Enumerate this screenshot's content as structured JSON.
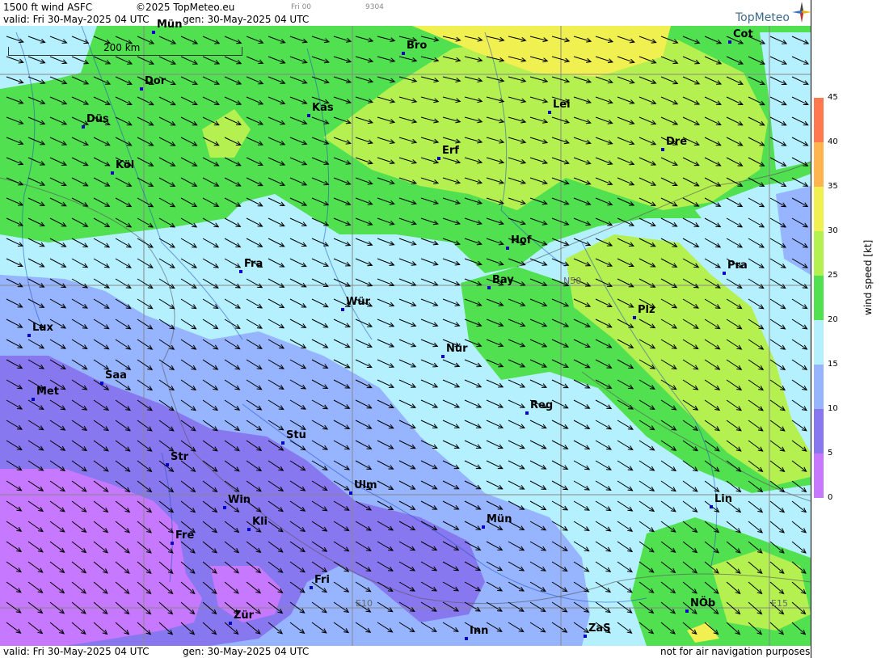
{
  "header": {
    "product": "1500 ft wind ASFC",
    "copyright": "©2025 TopMeteo.eu",
    "valid_line": "valid:  Fri  30-May-2025  04 UTC",
    "gen_line": "gen: 30-May-2025 04 UTC",
    "small_tag_1": "Fri 00",
    "small_tag_2": "9304",
    "brand": "TopMeteo"
  },
  "footer": {
    "valid_line": "valid:  Fri  30-May-2025  04 UTC",
    "gen_line": "gen: 30-May-2025 04 UTC",
    "disclaimer": "not for air navigation purposes"
  },
  "scale": {
    "label": "200 km"
  },
  "legend": {
    "title": "wind speed [kt]",
    "ticks": [
      "0",
      "5",
      "10",
      "15",
      "20",
      "25",
      "30",
      "35",
      "40",
      "45"
    ],
    "colors": [
      "#c678ff",
      "#8878f0",
      "#96b4ff",
      "#b4f0ff",
      "#50e050",
      "#b4f050",
      "#f0f050",
      "#ffb450",
      "#ff7850"
    ]
  },
  "grid_labels": {
    "n50": "N50",
    "e10": "E10",
    "e15": "E15"
  },
  "cities": [
    {
      "name": "Mün"
    },
    {
      "name": "Bro"
    },
    {
      "name": "Cot"
    },
    {
      "name": "Dor"
    },
    {
      "name": "Kas"
    },
    {
      "name": "Lei"
    },
    {
      "name": "Düs"
    },
    {
      "name": "Erf"
    },
    {
      "name": "Dre"
    },
    {
      "name": "Köl"
    },
    {
      "name": "Hof"
    },
    {
      "name": "Fra"
    },
    {
      "name": "Pra"
    },
    {
      "name": "Bay"
    },
    {
      "name": "Wür"
    },
    {
      "name": "Plz"
    },
    {
      "name": "Lux"
    },
    {
      "name": "Nür"
    },
    {
      "name": "Saa"
    },
    {
      "name": "Met"
    },
    {
      "name": "Reg"
    },
    {
      "name": "Stu"
    },
    {
      "name": "Str"
    },
    {
      "name": "Ulm"
    },
    {
      "name": "Lin"
    },
    {
      "name": "Win"
    },
    {
      "name": "Kli"
    },
    {
      "name": "Mün"
    },
    {
      "name": "Fre"
    },
    {
      "name": "Fri"
    },
    {
      "name": "NÖb"
    },
    {
      "name": "Zür"
    },
    {
      "name": "ZaS"
    },
    {
      "name": "Inn"
    }
  ]
}
